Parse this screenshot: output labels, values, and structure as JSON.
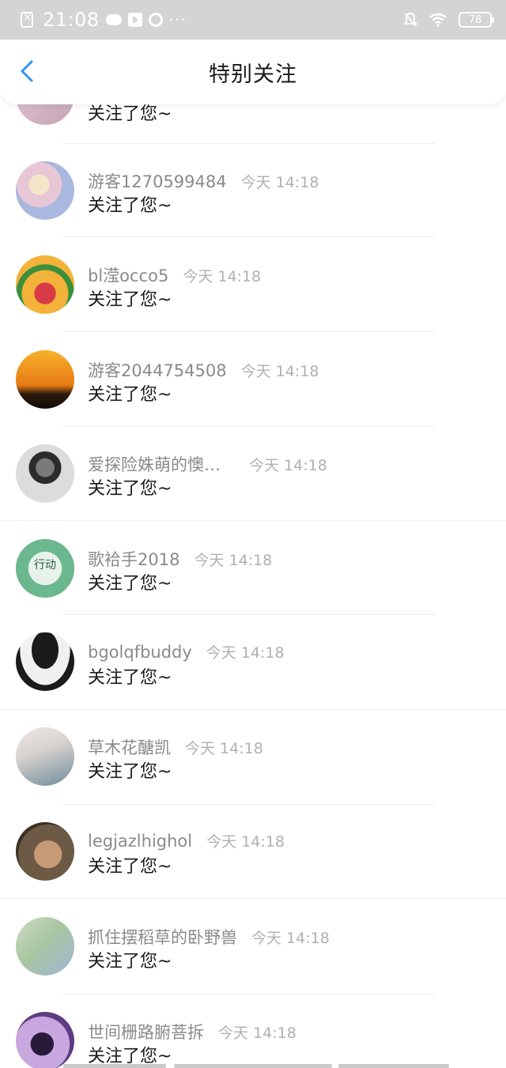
{
  "status_bar": {
    "time": "21:08",
    "battery": "78"
  },
  "header": {
    "title": "特别关注"
  },
  "partial_item": {
    "message": "关注了您~"
  },
  "items": [
    {
      "name": "游客1270599484",
      "time": "今天 14:18",
      "message": "关注了您~",
      "avatar_colors": [
        "#e7c7d6",
        "#a9b8df"
      ]
    },
    {
      "name": "bl滢occo5",
      "time": "今天 14:18",
      "message": "关注了您~",
      "avatar_colors": [
        "#f3b23a",
        "#d83b45"
      ]
    },
    {
      "name": "游客2044754508",
      "time": "今天 14:18",
      "message": "关注了您~",
      "avatar_colors": [
        "#f2a01e",
        "#2a1a0c"
      ]
    },
    {
      "name": "爱探险姝萌的懊…",
      "time": "今天 14:18",
      "message": "关注了您~",
      "avatar_colors": [
        "#e5e5e5",
        "#5a5a5a"
      ]
    },
    {
      "name": "歌袷手2018",
      "time": "今天 14:18",
      "message": "关注了您~",
      "avatar_colors": [
        "#9fd3b4",
        "#3d8a63"
      ],
      "avatar_text": "行动"
    },
    {
      "name": "bgolqfbuddy",
      "time": "今天 14:18",
      "message": "关注了您~",
      "avatar_colors": [
        "#f0f0f0",
        "#1b1b1b"
      ]
    },
    {
      "name": "草木花醣凯",
      "time": "今天 14:18",
      "message": "关注了您~",
      "avatar_colors": [
        "#d8d2cf",
        "#6e8d9a"
      ]
    },
    {
      "name": "legjazlhighol",
      "time": "今天 14:18",
      "message": "关注了您~",
      "avatar_colors": [
        "#6c5a44",
        "#c79a77"
      ]
    },
    {
      "name": "抓住摆稻草的卧野兽",
      "time": "今天 14:18",
      "message": "关注了您~",
      "avatar_colors": [
        "#a8c6a0",
        "#9fb6d6"
      ]
    },
    {
      "name": "世间栅路腑菩拆",
      "time": "今天 14:18",
      "message": "关注了您~",
      "avatar_colors": [
        "#c8a7df",
        "#5e3c82"
      ]
    }
  ],
  "colors": {
    "accent": "#2f96f3",
    "name_text": "#8a8a8a",
    "time_text": "#b0b0b0"
  }
}
